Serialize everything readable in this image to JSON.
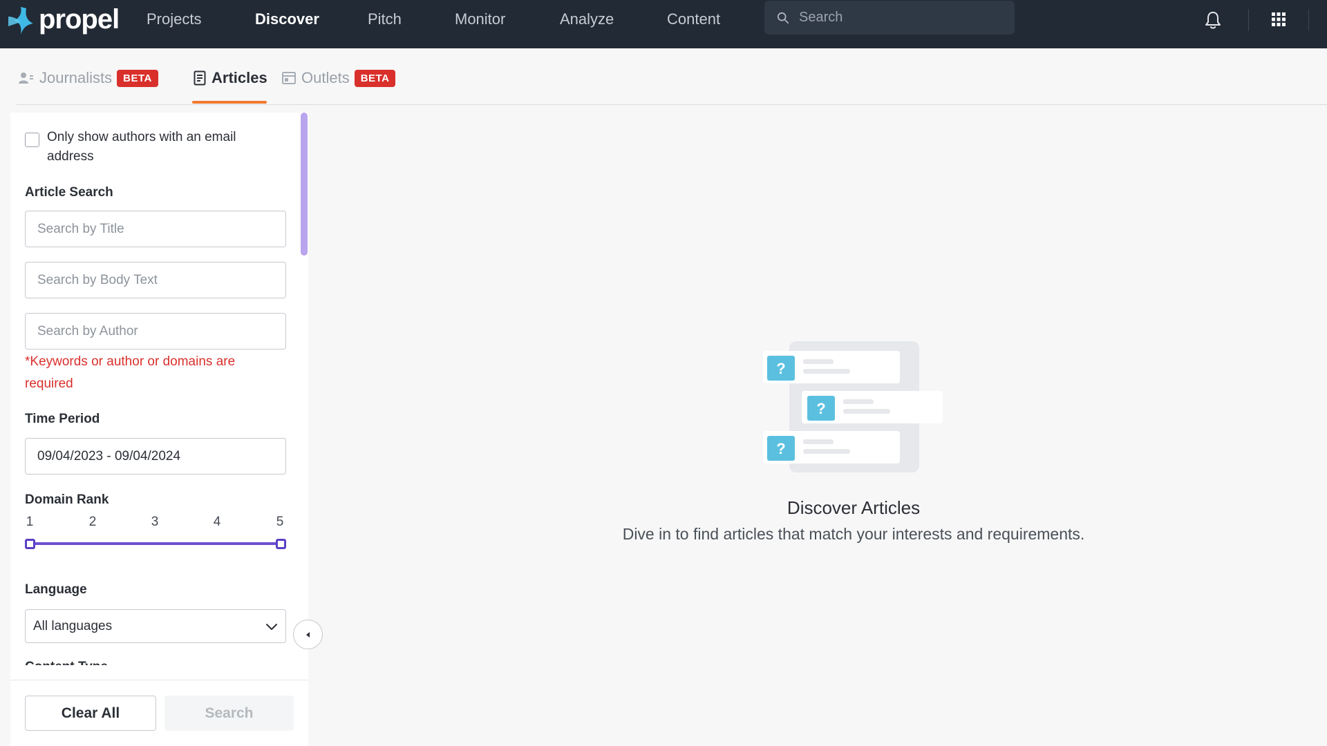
{
  "app": {
    "brand": "propel"
  },
  "nav": {
    "items": [
      {
        "label": "Projects"
      },
      {
        "label": "Discover"
      },
      {
        "label": "Pitch"
      },
      {
        "label": "Monitor"
      },
      {
        "label": "Analyze"
      },
      {
        "label": "Content"
      }
    ],
    "active": "Discover",
    "search_placeholder": "Search"
  },
  "subtabs": {
    "journalists": {
      "label": "Journalists",
      "badge": "BETA"
    },
    "articles": {
      "label": "Articles"
    },
    "outlets": {
      "label": "Outlets",
      "badge": "BETA"
    },
    "active": "Articles"
  },
  "filters": {
    "email_only": {
      "label": "Only show authors with an email address",
      "checked": false
    },
    "article_search": {
      "title": "Article Search",
      "title_placeholder": "Search by Title",
      "body_placeholder": "Search by Body Text",
      "author_placeholder": "Search by Author",
      "error": "*Keywords or author or domains are required"
    },
    "time_period": {
      "title": "Time Period",
      "value": "09/04/2023 - 09/04/2024"
    },
    "domain_rank": {
      "title": "Domain Rank",
      "ticks": [
        "1",
        "2",
        "3",
        "4",
        "5"
      ],
      "min": 1,
      "max": 5
    },
    "language": {
      "title": "Language",
      "value": "All languages"
    },
    "content_type": {
      "title": "Content Type"
    }
  },
  "actions": {
    "clear": "Clear All",
    "search": "Search"
  },
  "empty_state": {
    "title": "Discover Articles",
    "description": "Dive in to find articles that match your interests and requirements."
  },
  "colors": {
    "navbar": "#222a35",
    "accent_orange": "#f07a2f",
    "beta_red": "#d9302c",
    "slider_purple": "#5b3fc4",
    "brand_blue": "#3fb8e6"
  },
  "icons": {
    "journalists": "journalist-icon",
    "articles": "article-icon",
    "outlets": "outlet-icon",
    "notifications": "bell-icon",
    "apps": "grid-icon",
    "search": "search-icon"
  }
}
